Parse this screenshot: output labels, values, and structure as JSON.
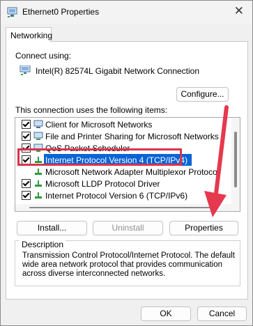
{
  "window": {
    "title": "Ethernet0 Properties"
  },
  "tabs": [
    {
      "label": "Networking"
    }
  ],
  "connect_using": {
    "label": "Connect using:",
    "adapter": "Intel(R) 82574L Gigabit Network Connection",
    "configure_label": "Configure..."
  },
  "items": {
    "label": "This connection uses the following items:",
    "list": [
      {
        "label": "Client for Microsoft Networks",
        "checked": true,
        "icon": "network-client-icon"
      },
      {
        "label": "File and Printer Sharing for Microsoft Networks",
        "checked": true,
        "icon": "network-service-icon"
      },
      {
        "label": "QoS Packet Scheduler",
        "checked": true,
        "icon": "network-service-icon"
      },
      {
        "label": "Internet Protocol Version 4 (TCP/IPv4)",
        "checked": true,
        "selected": true,
        "icon": "network-protocol-icon"
      },
      {
        "label": "Microsoft Network Adapter Multiplexor Protocol",
        "checked": false,
        "icon": "network-protocol-icon"
      },
      {
        "label": "Microsoft LLDP Protocol Driver",
        "checked": true,
        "icon": "network-protocol-icon"
      },
      {
        "label": "Internet Protocol Version 6 (TCP/IPv6)",
        "checked": true,
        "icon": "network-protocol-icon"
      }
    ]
  },
  "buttons": {
    "install": "Install...",
    "uninstall": "Uninstall",
    "properties": "Properties"
  },
  "description": {
    "title": "Description",
    "text_lines": [
      "Transmission Control Protocol/Internet Protocol. The default",
      "wide area network protocol that provides communication",
      "across diverse interconnected networks."
    ]
  },
  "footer": {
    "ok": "OK",
    "cancel": "Cancel"
  },
  "colors": {
    "accent": "#0a64d6",
    "highlight_box": "#d9344e",
    "arrow": "#e5394f"
  }
}
